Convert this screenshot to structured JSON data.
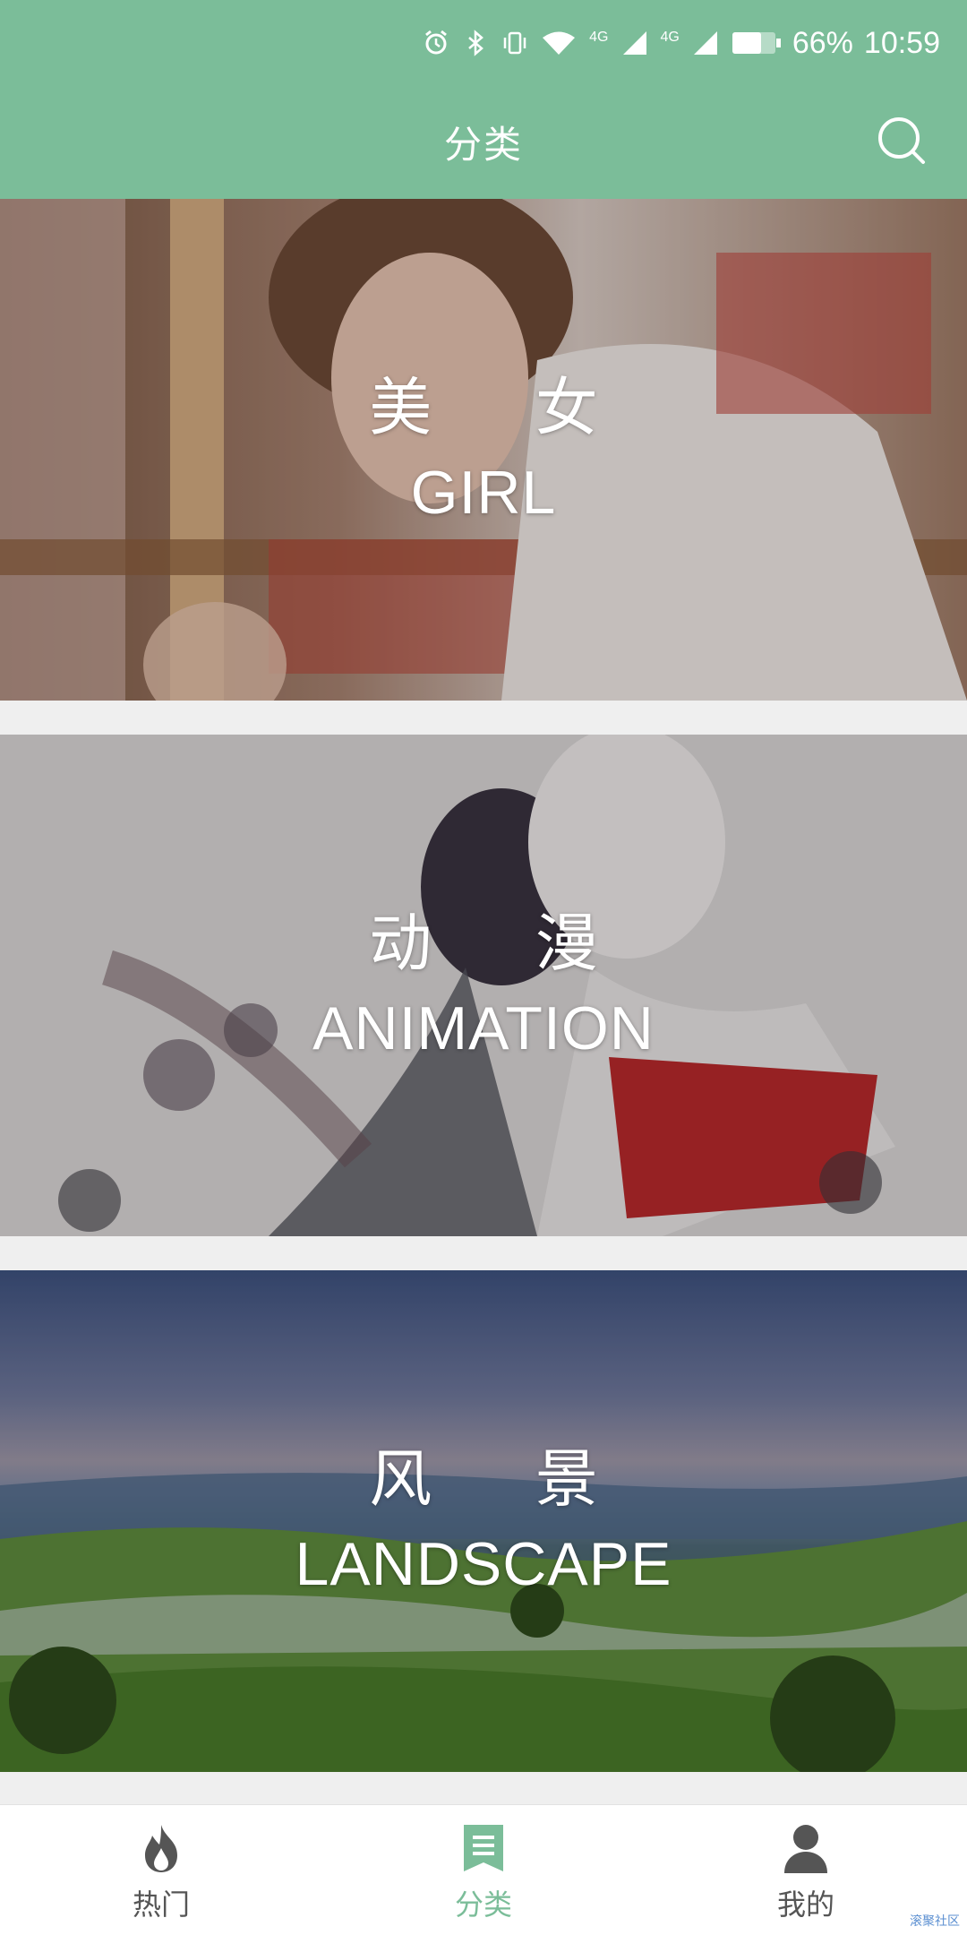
{
  "status_bar": {
    "battery": "66%",
    "time": "10:59",
    "network_1": "4G",
    "network_2": "4G",
    "icons": [
      "alarm-icon",
      "bluetooth-icon",
      "vibrate-icon",
      "wifi-icon",
      "signal-icon",
      "signal-icon",
      "battery-icon"
    ]
  },
  "header": {
    "title": "分类",
    "search_icon": "search-icon"
  },
  "categories": [
    {
      "cn": "美 女",
      "en": "GIRL"
    },
    {
      "cn": "动 漫",
      "en": "ANIMATION"
    },
    {
      "cn": "风 景",
      "en": "LANDSCAPE"
    }
  ],
  "tabbar": {
    "items": [
      {
        "label": "热门",
        "icon": "flame-icon"
      },
      {
        "label": "分类",
        "icon": "bookmark-list-icon"
      },
      {
        "label": "我的",
        "icon": "person-icon"
      }
    ],
    "active": "分类"
  },
  "watermark": "滚聚社区",
  "colors": {
    "accent": "#7bbd99",
    "tab_inactive": "#555555"
  }
}
